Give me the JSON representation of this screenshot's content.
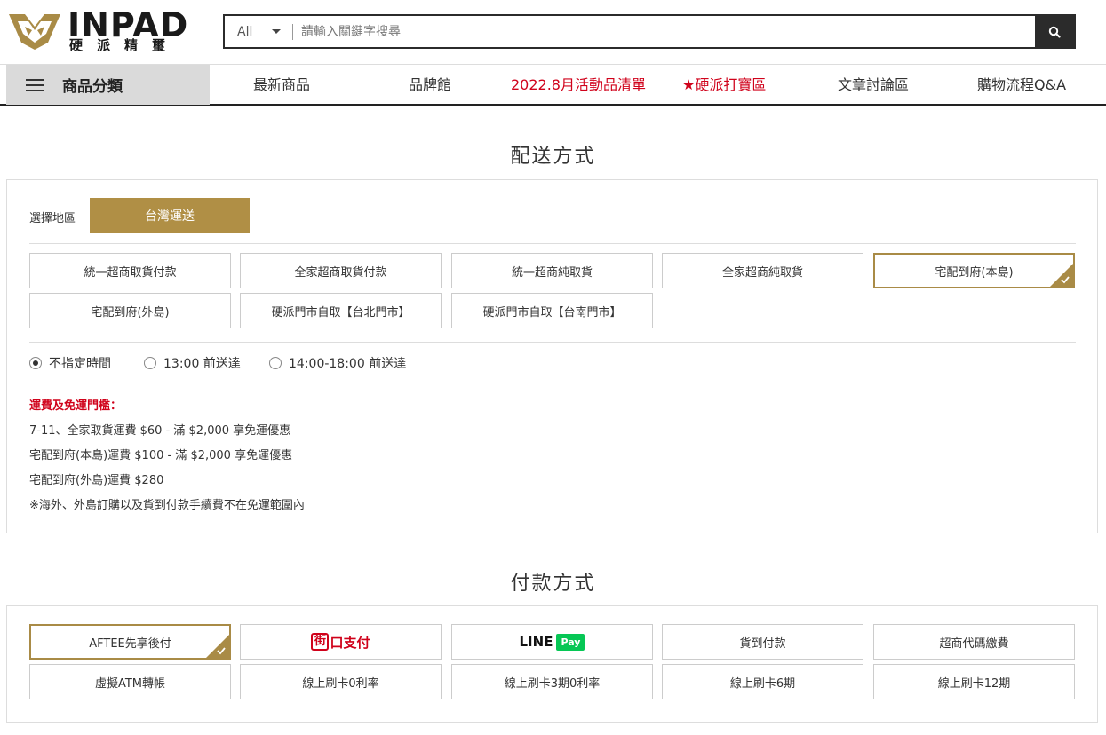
{
  "brand": {
    "name": "INPAD",
    "sub": "硬派精璽"
  },
  "search": {
    "scope": "All",
    "placeholder": "請輸入關鍵字搜尋"
  },
  "nav": {
    "category_label": "商品分類",
    "items": [
      {
        "label": "最新商品"
      },
      {
        "label": "品牌館"
      },
      {
        "label": "2022.8月活動品清單"
      },
      {
        "label": "★硬派打寶區"
      },
      {
        "label": "文章討論區"
      },
      {
        "label": "購物流程Q&A"
      }
    ]
  },
  "delivery": {
    "title": "配送方式",
    "region_label": "選擇地區",
    "region_value": "台灣運送",
    "options": [
      {
        "label": "統一超商取貨付款"
      },
      {
        "label": "全家超商取貨付款"
      },
      {
        "label": "統一超商純取貨"
      },
      {
        "label": "全家超商純取貨"
      },
      {
        "label": "宅配到府(本島)"
      },
      {
        "label": "宅配到府(外島)"
      },
      {
        "label": "硬派門市自取【台北門市】"
      },
      {
        "label": "硬派門市自取【台南門市】"
      }
    ],
    "selected_index": 4,
    "time_options": [
      {
        "label": "不指定時間"
      },
      {
        "label": "13:00 前送達"
      },
      {
        "label": "14:00-18:00 前送達"
      }
    ],
    "fee_title": "運費及免運門檻：",
    "fee_lines": [
      "7-11、全家取貨運費 $60 - 滿 $2,000 享免運優惠",
      "宅配到府(本島)運費 $100 - 滿 $2,000 享免運優惠",
      "宅配到府(外島)運費 $280",
      "※海外、外島訂購以及貨到付款手續費不在免運範圍內"
    ]
  },
  "payment": {
    "title": "付款方式",
    "options": [
      {
        "label": "AFTEE先享後付"
      },
      {
        "label": "口支付",
        "logo_char": "街"
      },
      {
        "label": "LINE",
        "badge": "Pay"
      },
      {
        "label": "貨到付款"
      },
      {
        "label": "超商代碼繳費"
      },
      {
        "label": "虛擬ATM轉帳"
      },
      {
        "label": "線上刷卡0利率"
      },
      {
        "label": "線上刷卡3期0利率"
      },
      {
        "label": "線上刷卡6期"
      },
      {
        "label": "線上刷卡12期"
      }
    ],
    "selected_index": 0
  },
  "colors": {
    "gold": "#b08f45",
    "red": "#d0021b",
    "dark": "#2b2b2b",
    "line_green": "#06c755"
  }
}
